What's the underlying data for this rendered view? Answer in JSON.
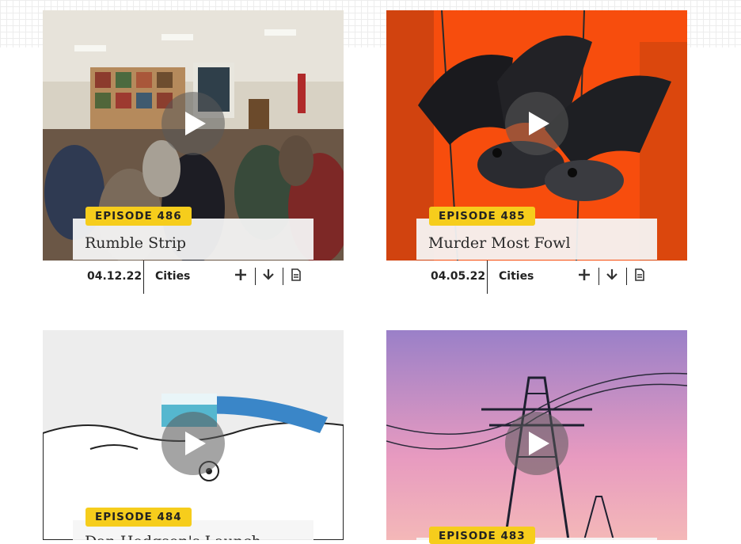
{
  "episodes": [
    {
      "badge": "EPISODE 486",
      "title": "Rumble Strip",
      "date": "04.12.22",
      "category": "Cities"
    },
    {
      "badge": "EPISODE 485",
      "title": "Murder Most Fowl",
      "date": "04.05.22",
      "category": "Cities"
    },
    {
      "badge": "EPISODE 484",
      "title": "Dan Hodgson's Launch",
      "date": "",
      "category": ""
    },
    {
      "badge": "EPISODE 483",
      "title": "",
      "date": "",
      "category": ""
    }
  ],
  "colors": {
    "badge": "#f6cd1c",
    "text": "#222222"
  },
  "icons": [
    "play-icon",
    "plus-icon",
    "download-icon",
    "transcript-icon"
  ]
}
